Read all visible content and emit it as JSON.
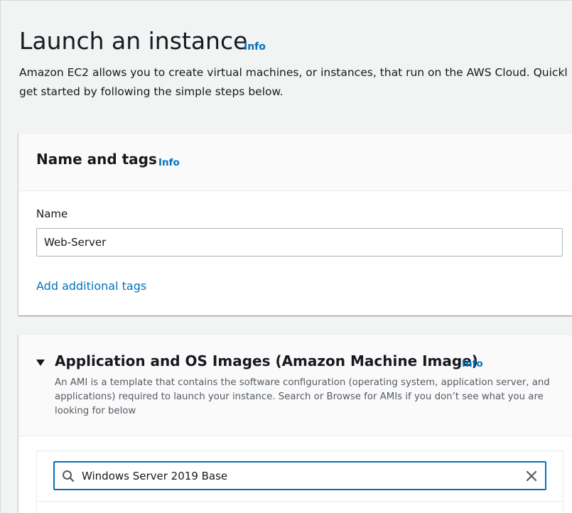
{
  "page": {
    "title": "Launch an instance",
    "info_label": "Info",
    "description_lines": [
      "Amazon EC2 allows you to create virtual machines, or instances, that run on the AWS Cloud. Quickl",
      "get started by following the simple steps below."
    ]
  },
  "name_and_tags": {
    "title": "Name and tags",
    "info_label": "Info",
    "name_label": "Name",
    "name_value": "Web-Server",
    "add_tags_label": "Add additional tags"
  },
  "ami_section": {
    "title": "Application and OS Images (Amazon Machine Image)",
    "info_label": "Info",
    "description_lines": [
      "An AMI is a template that contains the software configuration (operating system, application server, and",
      "applications) required to launch your instance. Search or Browse for AMIs if you don’t see what you are",
      "looking for below"
    ],
    "search_value": "Windows Server 2019 Base"
  },
  "colors": {
    "link": "#0073bb",
    "background": "#f2f3f3",
    "text": "#16191f",
    "focus_border": "#0073bb"
  },
  "icons": {
    "search": "search-icon",
    "clear": "close-icon",
    "collapse": "caret-down-icon"
  }
}
